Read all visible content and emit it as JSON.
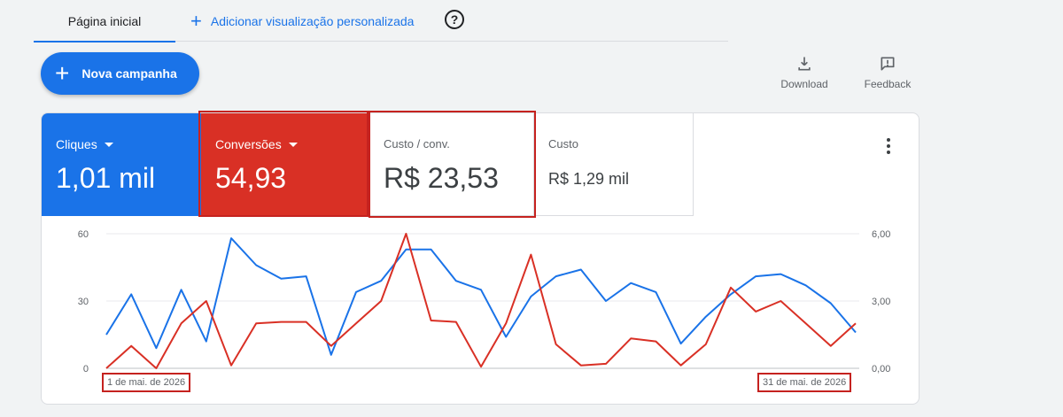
{
  "tabs": {
    "home": "Página inicial",
    "add_view": "Adicionar visualização personalizada"
  },
  "new_campaign_label": "Nova campanha",
  "tools": {
    "download": "Download",
    "feedback": "Feedback"
  },
  "metrics": {
    "clicks": {
      "label": "Cliques",
      "value": "1,01 mil",
      "color": "#1a73e8"
    },
    "conversions": {
      "label": "Conversões",
      "value": "54,93",
      "color": "#d93025"
    },
    "cost_per_conv": {
      "label": "Custo / conv.",
      "value": "R$ 23,53"
    },
    "cost": {
      "label": "Custo",
      "value": "R$ 1,29 mil"
    }
  },
  "chart_data": {
    "type": "line",
    "x_start_label": "1 de mai. de 2026",
    "x_end_label": "31 de mai. de 2026",
    "left_axis_ticks": [
      "0",
      "30",
      "60"
    ],
    "right_axis_ticks": [
      "0,00",
      "3,00",
      "6,00"
    ],
    "ylim_left": [
      0,
      60
    ],
    "ylim_right": [
      0,
      6
    ],
    "grid": true,
    "series": [
      {
        "name": "Cliques",
        "axis": "left",
        "color": "#1a73e8",
        "values": [
          15,
          33,
          9,
          35,
          12,
          58,
          46,
          40,
          41,
          6,
          34,
          39,
          53,
          53,
          39,
          35,
          14,
          32,
          41,
          44,
          30,
          38,
          34,
          11,
          23,
          33,
          41,
          42,
          37,
          29,
          16
        ]
      },
      {
        "name": "Conversões",
        "axis": "right",
        "color": "#d93025",
        "values": [
          0,
          1.0,
          0,
          2.0,
          3.0,
          0.13,
          2.0,
          2.07,
          2.07,
          1.0,
          2.0,
          3.0,
          6.0,
          2.13,
          2.07,
          0.07,
          2.0,
          5.07,
          1.07,
          0.13,
          0.2,
          1.33,
          1.2,
          0.13,
          1.07,
          3.6,
          2.53,
          3.0,
          2.0,
          1.0,
          2.0
        ]
      }
    ]
  }
}
